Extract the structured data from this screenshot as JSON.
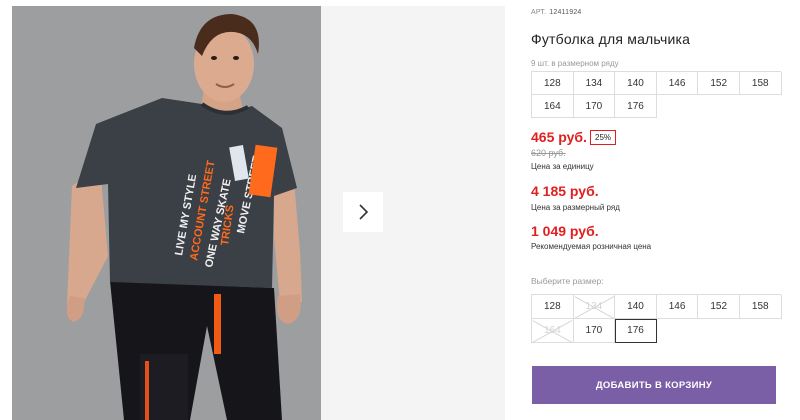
{
  "gallery": {
    "next_icon": "chevron-right-icon"
  },
  "product": {
    "sku_label": "АРТ.",
    "sku_value": "12411924",
    "title": "Футболка для мальчика",
    "pack_note": "9 шт. в размерном ряду",
    "pack_sizes": [
      "128",
      "134",
      "140",
      "146",
      "152",
      "158",
      "164",
      "170",
      "176"
    ],
    "price": "465 руб.",
    "discount": "25%",
    "old_price": "620 руб.",
    "unit_note": "Цена за единицу",
    "pack_price": "4 185 руб.",
    "pack_price_note": "Цена за размерный ряд",
    "rrp": "1 049 руб.",
    "rrp_note": "Рекомендуемая розничная цена",
    "size_label": "Выберите размер:",
    "sizes": [
      {
        "label": "128",
        "available": true,
        "selected": false
      },
      {
        "label": "134",
        "available": false,
        "selected": false
      },
      {
        "label": "140",
        "available": true,
        "selected": false
      },
      {
        "label": "146",
        "available": true,
        "selected": false
      },
      {
        "label": "152",
        "available": true,
        "selected": false
      },
      {
        "label": "158",
        "available": true,
        "selected": false
      },
      {
        "label": "164",
        "available": false,
        "selected": false
      },
      {
        "label": "170",
        "available": true,
        "selected": false
      },
      {
        "label": "176",
        "available": true,
        "selected": true
      }
    ],
    "cart_button": "ДОБАВИТЬ В КОРЗИНУ"
  },
  "colors": {
    "price_red": "#e02020",
    "button_purple": "#7a5ea6"
  }
}
